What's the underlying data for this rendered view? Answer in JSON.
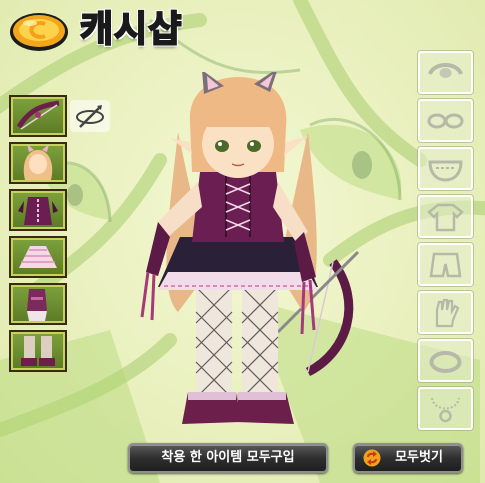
{
  "header": {
    "title": "캐시샵",
    "coin_icon": "gold-coin-icon"
  },
  "equipped_slots": [
    {
      "name": "equipped-weapon-bow",
      "icon": "bow-icon"
    },
    {
      "name": "equipped-hair",
      "icon": "hair-icon"
    },
    {
      "name": "equipped-top",
      "icon": "top-icon"
    },
    {
      "name": "equipped-skirt",
      "icon": "skirt-icon"
    },
    {
      "name": "equipped-gloves",
      "icon": "gloves-icon"
    },
    {
      "name": "equipped-shoes",
      "icon": "shoes-icon"
    }
  ],
  "rotate_icon": "rotate-view-icon",
  "category_slots": [
    {
      "name": "category-headgear",
      "icon": "headband-icon"
    },
    {
      "name": "category-face",
      "icon": "glasses-icon"
    },
    {
      "name": "category-mouth",
      "icon": "mask-icon"
    },
    {
      "name": "category-top",
      "icon": "shirt-icon"
    },
    {
      "name": "category-bottom",
      "icon": "shorts-icon"
    },
    {
      "name": "category-gloves",
      "icon": "glove-icon"
    },
    {
      "name": "category-ring",
      "icon": "ring-icon"
    },
    {
      "name": "category-necklace",
      "icon": "necklace-icon"
    }
  ],
  "buttons": {
    "buy_all": "착용 한 아이템 모두구입",
    "unequip_all": "모두벗기",
    "swap_icon": "swap-arrows-icon"
  },
  "colors": {
    "title_red": "#e4212d",
    "background_green": "#e9f0bb",
    "button_dark": "#2f2f2f"
  }
}
